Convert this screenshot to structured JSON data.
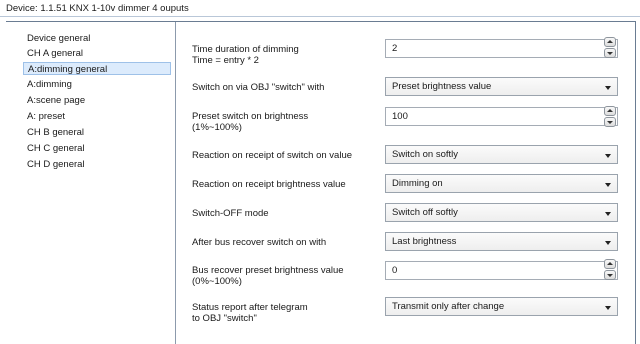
{
  "window": {
    "title": "Device: 1.1.51  KNX 1-10v dimmer  4 ouputs"
  },
  "sidebar": {
    "items": [
      {
        "label": "Device general"
      },
      {
        "label": "CH A general"
      },
      {
        "label": "A:dimming general",
        "selected": true
      },
      {
        "label": "A:dimming"
      },
      {
        "label": "A:scene page"
      },
      {
        "label": "A: preset"
      },
      {
        "label": "CH B general"
      },
      {
        "label": "CH C general"
      },
      {
        "label": "CH D general"
      }
    ]
  },
  "params": [
    {
      "label_line1": "Time duration of dimming",
      "label_line2": "Time = entry * 2",
      "type": "spin",
      "value": "2"
    },
    {
      "label_line1": "Switch on via OBJ \"switch\" with",
      "label_line2": "",
      "type": "dropdown",
      "value": "Preset brightness value"
    },
    {
      "label_line1": "Preset switch on brightness",
      "label_line2": "(1%~100%)",
      "type": "spin",
      "value": "100"
    },
    {
      "label_line1": "Reaction on receipt of switch on value",
      "label_line2": "",
      "type": "dropdown",
      "value": "Switch on softly"
    },
    {
      "label_line1": "Reaction on receipt brightness value",
      "label_line2": "",
      "type": "dropdown",
      "value": "Dimming on"
    },
    {
      "label_line1": "Switch-OFF mode",
      "label_line2": "",
      "type": "dropdown",
      "value": "Switch off softly"
    },
    {
      "label_line1": "After bus recover switch on with",
      "label_line2": "",
      "type": "dropdown",
      "value": "Last brightness"
    },
    {
      "label_line1": "Bus recover preset brightness value",
      "label_line2": "(0%~100%)",
      "type": "spin",
      "value": "0"
    },
    {
      "label_line1": "Status report after telegram",
      "label_line2": "to OBJ \"switch\"",
      "type": "dropdown",
      "value": "Transmit only after change"
    }
  ],
  "colors": {
    "selection": "#dcebfc",
    "border": "#6a7c92"
  }
}
